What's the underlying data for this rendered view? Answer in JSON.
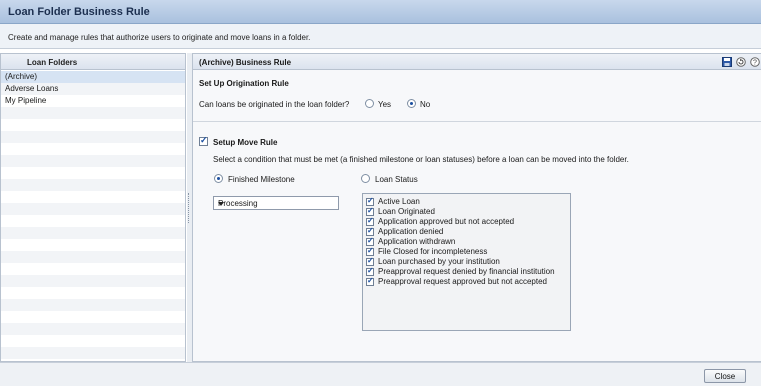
{
  "window": {
    "title": "Loan Folder Business Rule"
  },
  "description": "Create and manage rules that authorize users to originate and move loans in a folder.",
  "left_panel": {
    "header": "Loan Folders",
    "items": [
      "(Archive)",
      "Adverse Loans",
      "My Pipeline"
    ],
    "selected_index": 0
  },
  "right_panel": {
    "header": "(Archive) Business Rule",
    "icons": [
      "save-icon",
      "reset-icon",
      "help-icon"
    ],
    "origination": {
      "title": "Set Up Origination Rule",
      "question": "Can loans be originated in the loan folder?",
      "yes_label": "Yes",
      "no_label": "No",
      "selected": "No"
    },
    "move_rule": {
      "checkbox_label": "Setup Move Rule",
      "checked": true,
      "instruction": "Select a condition that must be met (a finished milestone or loan statuses) before a loan can be moved into the folder.",
      "option_milestone": "Finished Milestone",
      "option_status": "Loan Status",
      "selected_option": "Finished Milestone",
      "milestone_value": "Processing",
      "statuses": [
        {
          "label": "Active Loan",
          "checked": true
        },
        {
          "label": "Loan Originated",
          "checked": true
        },
        {
          "label": "Application approved but not accepted",
          "checked": true
        },
        {
          "label": "Application denied",
          "checked": true
        },
        {
          "label": "Application withdrawn",
          "checked": true
        },
        {
          "label": "File Closed for incompleteness",
          "checked": true
        },
        {
          "label": "Loan purchased by your institution",
          "checked": true
        },
        {
          "label": "Preapproval request denied by financial institution",
          "checked": true
        },
        {
          "label": "Preapproval request approved but not accepted",
          "checked": true
        }
      ]
    }
  },
  "footer": {
    "close_label": "Close"
  }
}
